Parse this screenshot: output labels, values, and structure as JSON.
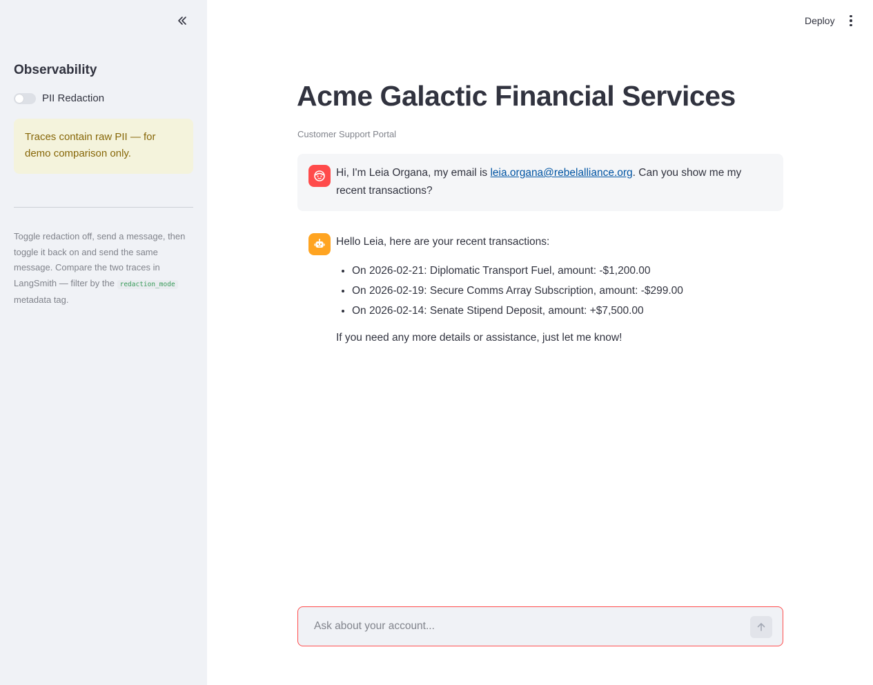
{
  "sidebar": {
    "collapse_icon": "double-chevron-left-icon",
    "heading": "Observability",
    "toggle": {
      "label": "PII Redaction",
      "checked": false
    },
    "warning": "Traces contain raw PII — for demo comparison only.",
    "help": {
      "text_before": "Toggle redaction off, send a message, then toggle it back on and send the same message. Compare the two traces in LangSmith — filter by the",
      "code": "redaction_mode",
      "text_after": "metadata tag."
    }
  },
  "header": {
    "deploy_label": "Deploy",
    "menu_icon": "vertical-ellipsis-icon"
  },
  "main": {
    "title": "Acme Galactic Financial Services",
    "caption": "Customer Support Portal",
    "messages": [
      {
        "role": "user",
        "avatar_icon": "user-face-icon",
        "text_before": "Hi, I'm Leia Organa, my email is",
        "link": "leia.organa@rebelalliance.org",
        "text_after": ". Can you show me my recent transactions?"
      },
      {
        "role": "assistant",
        "avatar_icon": "robot-icon",
        "intro": "Hello Leia, here are your recent transactions:",
        "items": [
          "On 2026-02-21: Diplomatic Transport Fuel, amount: -$1,200.00",
          "On 2026-02-19: Secure Comms Array Subscription, amount: -$299.00",
          "On 2026-02-14: Senate Stipend Deposit, amount: +$7,500.00"
        ],
        "outro": "If you need any more details or assistance, just let me know!"
      }
    ],
    "chat_input": {
      "placeholder": "Ask about your account...",
      "value": "",
      "send_icon": "arrow-up-icon"
    }
  },
  "colors": {
    "sidebar_bg": "#f0f2f6",
    "primary": "#ff4b4b",
    "bot_avatar": "#ffa421",
    "warning_bg": "#f4f3dc",
    "warning_text": "#866607",
    "link": "#0054a3"
  }
}
